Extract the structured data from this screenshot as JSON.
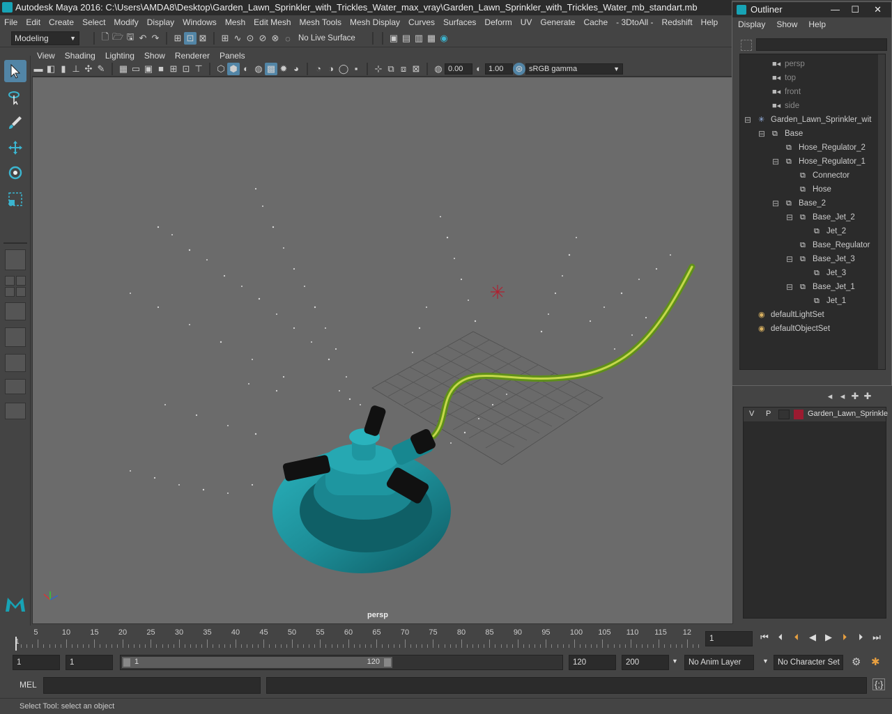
{
  "window": {
    "title": "Autodesk Maya 2016: C:\\Users\\AMDA8\\Desktop\\Garden_Lawn_Sprinkler_with_Trickles_Water_max_vray\\Garden_Lawn_Sprinkler_with_Trickles_Water_mb_standart.mb"
  },
  "menubar": [
    "File",
    "Edit",
    "Create",
    "Select",
    "Modify",
    "Display",
    "Windows",
    "Mesh",
    "Edit Mesh",
    "Mesh Tools",
    "Mesh Display",
    "Curves",
    "Surfaces",
    "Deform",
    "UV",
    "Generate",
    "Cache",
    "- 3DtoAll -",
    "Redshift",
    "Help"
  ],
  "shelf": {
    "mode": "Modeling",
    "live_surface": "No Live Surface"
  },
  "viewport": {
    "menus": [
      "View",
      "Shading",
      "Lighting",
      "Show",
      "Renderer",
      "Panels"
    ],
    "exposure": "0.00",
    "gamma": "1.00",
    "color_space": "sRGB gamma",
    "camera_label": "persp"
  },
  "outliner": {
    "title": "Outliner",
    "menus": [
      "Display",
      "Show",
      "Help"
    ],
    "items": [
      {
        "label": "persp",
        "type": "camera"
      },
      {
        "label": "top",
        "type": "camera"
      },
      {
        "label": "front",
        "type": "camera"
      },
      {
        "label": "side",
        "type": "camera"
      },
      {
        "label": "Garden_Lawn_Sprinkler_wit",
        "type": "group"
      },
      {
        "label": "Base",
        "type": "mesh"
      },
      {
        "label": "Hose_Regulator_2",
        "type": "mesh"
      },
      {
        "label": "Hose_Regulator_1",
        "type": "mesh"
      },
      {
        "label": "Connector",
        "type": "mesh"
      },
      {
        "label": "Hose",
        "type": "mesh"
      },
      {
        "label": "Base_2",
        "type": "mesh"
      },
      {
        "label": "Base_Jet_2",
        "type": "mesh"
      },
      {
        "label": "Jet_2",
        "type": "mesh"
      },
      {
        "label": "Base_Regulator",
        "type": "mesh"
      },
      {
        "label": "Base_Jet_3",
        "type": "mesh"
      },
      {
        "label": "Jet_3",
        "type": "mesh"
      },
      {
        "label": "Base_Jet_1",
        "type": "mesh"
      },
      {
        "label": "Jet_1",
        "type": "mesh"
      },
      {
        "label": "defaultLightSet",
        "type": "set"
      },
      {
        "label": "defaultObjectSet",
        "type": "set"
      }
    ]
  },
  "layers": {
    "v": "V",
    "p": "P",
    "layer_name": "Garden_Lawn_Sprinkle",
    "layer_color": "#9b1b30"
  },
  "timeline": {
    "ticks": [
      "5",
      "10",
      "15",
      "20",
      "25",
      "30",
      "35",
      "40",
      "45",
      "50",
      "55",
      "60",
      "65",
      "70",
      "75",
      "80",
      "85",
      "90",
      "95",
      "100",
      "105",
      "110",
      "115",
      "12"
    ],
    "start_marker": "1",
    "current_frame": "1"
  },
  "range": {
    "start": "1",
    "playback_start": "1",
    "slider_start": "1",
    "slider_end": "120",
    "playback_end": "120",
    "end": "200",
    "anim_layer": "No Anim Layer",
    "character_set": "No Character Set"
  },
  "command": {
    "label": "MEL"
  },
  "status": {
    "text": "Select Tool: select an object"
  },
  "colors": {
    "sprinkler": "#1d8e98",
    "hose": "#8ab82a",
    "accent": "#5285a6"
  }
}
